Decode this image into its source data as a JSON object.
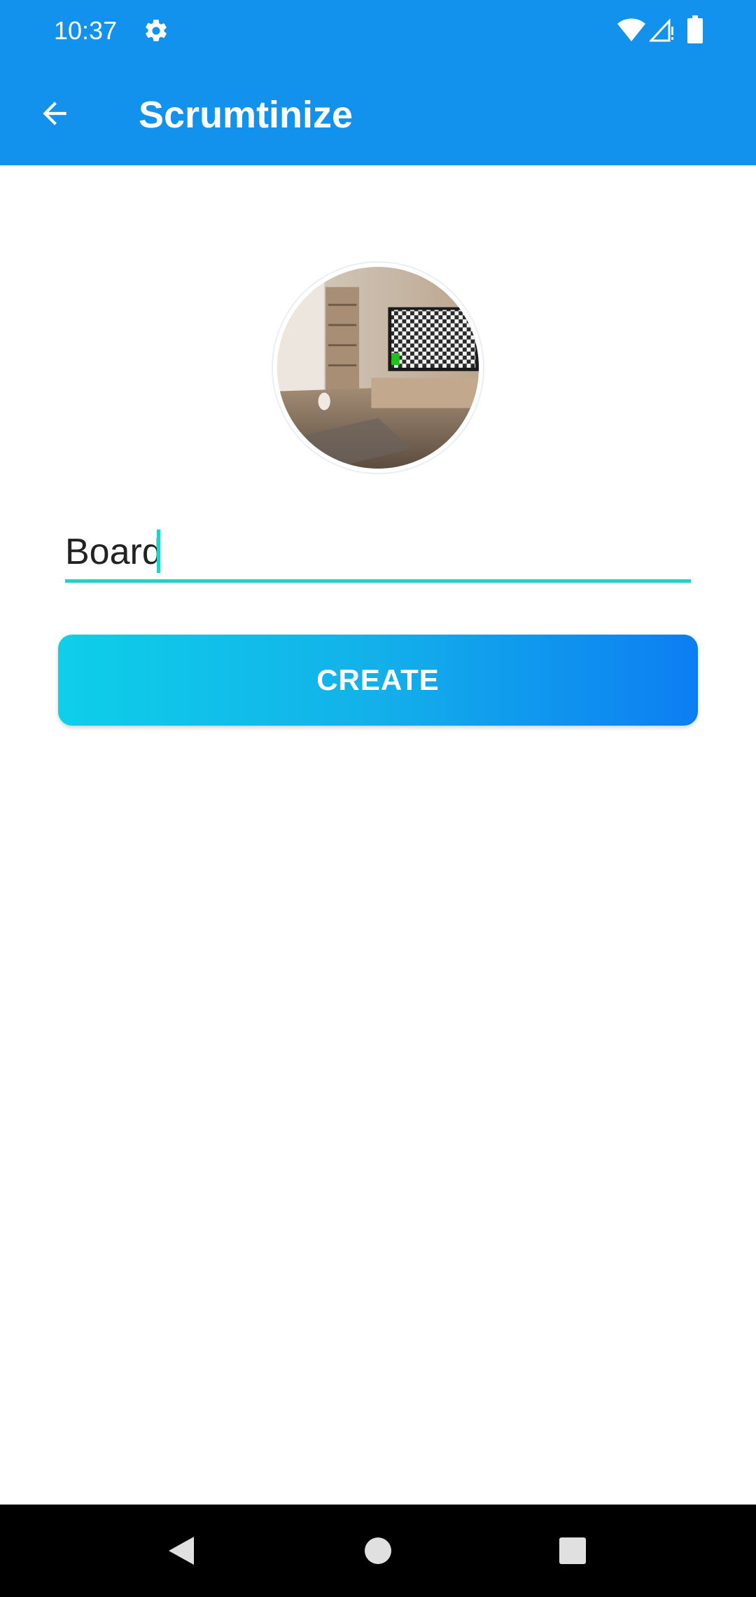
{
  "status_bar": {
    "time": "10:37",
    "icons": [
      "gear-icon",
      "wifi-icon",
      "signal-icon",
      "battery-icon"
    ]
  },
  "app_bar": {
    "title": "Scrumtinize",
    "back_icon": "arrow-left-icon"
  },
  "form": {
    "board_name_value": "Board",
    "create_label": "CREATE"
  },
  "nav_bar": {
    "icons": [
      "back-triangle-icon",
      "home-circle-icon",
      "recents-square-icon"
    ]
  },
  "colors": {
    "primary": "#1292ec",
    "accent": "#1fd3c5",
    "button_gradient_start": "#0ecfe9",
    "button_gradient_end": "#0c7ef2"
  }
}
